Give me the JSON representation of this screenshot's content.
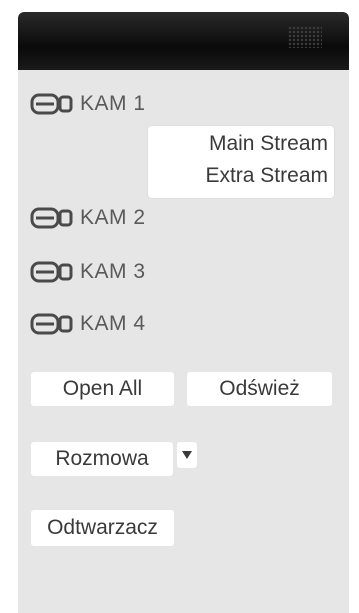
{
  "cameras": [
    {
      "label": "KAM 1"
    },
    {
      "label": "KAM 2"
    },
    {
      "label": "KAM 3"
    },
    {
      "label": "KAM 4"
    }
  ],
  "stream_menu": {
    "main": "Main Stream",
    "extra": "Extra Stream"
  },
  "buttons": {
    "open_all": "Open All",
    "refresh": "Odśwież",
    "talk": "Rozmowa",
    "player": "Odtwarzacz"
  },
  "icons": {
    "camera": "camera-icon",
    "dropdown": "chevron-down-icon"
  }
}
